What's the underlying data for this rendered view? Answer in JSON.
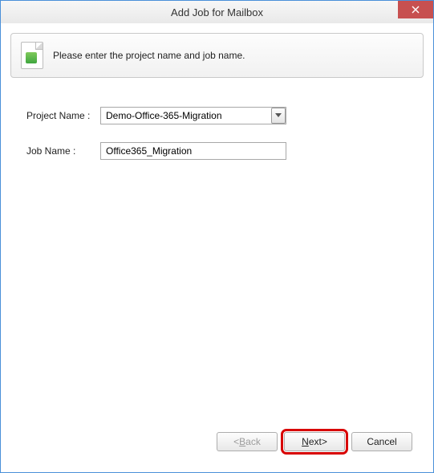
{
  "window": {
    "title": "Add Job for Mailbox"
  },
  "header": {
    "message": "Please enter the project name and job name."
  },
  "form": {
    "project_label": "Project Name :",
    "project_value": "Demo-Office-365-Migration",
    "job_label": "Job Name :",
    "job_value": "Office365_Migration"
  },
  "buttons": {
    "back": "< Back",
    "next": "Next >",
    "cancel": "Cancel"
  }
}
